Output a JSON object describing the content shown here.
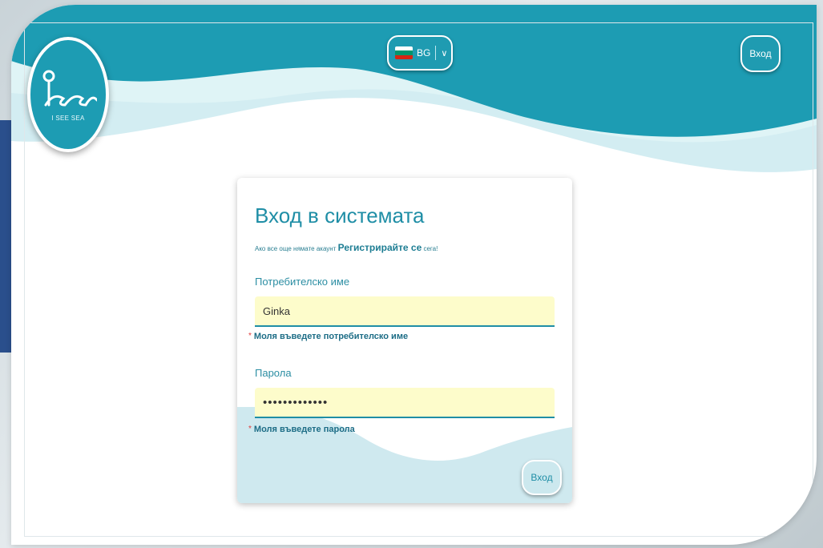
{
  "brand": {
    "logo_text": "I SEE SEA"
  },
  "header": {
    "language": {
      "code": "BG",
      "flag": [
        "#ffffff",
        "#00966e",
        "#d62612"
      ]
    },
    "login_button": "Вход"
  },
  "login_card": {
    "title": "Вход в системата",
    "subtitle_prefix": "Ако все още нямате акаунт",
    "register_link": "Регистрирайте се",
    "subtitle_suffix": "сега!",
    "username": {
      "label": "Потребителско име",
      "value": "Ginka",
      "error": "Моля въведете потребителско име"
    },
    "password": {
      "label": "Парола",
      "value": "•••••••••••••",
      "error": "Моля въведете парола"
    },
    "submit": "Вход"
  },
  "colors": {
    "accent": "#1f9bb1",
    "field_bg": "#fdfccb",
    "wave_light": "#cfe9ef"
  }
}
